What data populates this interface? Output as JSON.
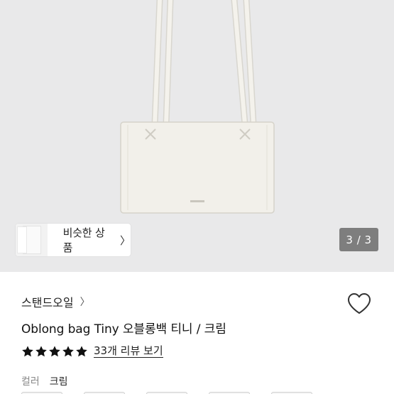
{
  "hero": {
    "similar_label": "비슷한 상품",
    "page_counter": "3 / 3"
  },
  "product": {
    "brand": "스탠드오일",
    "title": "Oblong bag Tiny 오블롱백 티니 / 크림",
    "rating_stars": 5,
    "review_link": "33개 리뷰 보기",
    "color_label": "컬러",
    "color_value": "크림"
  },
  "colors": {
    "hero_bg": "#e9e9ea",
    "bag": "#f1efe8",
    "star": "#111111"
  }
}
